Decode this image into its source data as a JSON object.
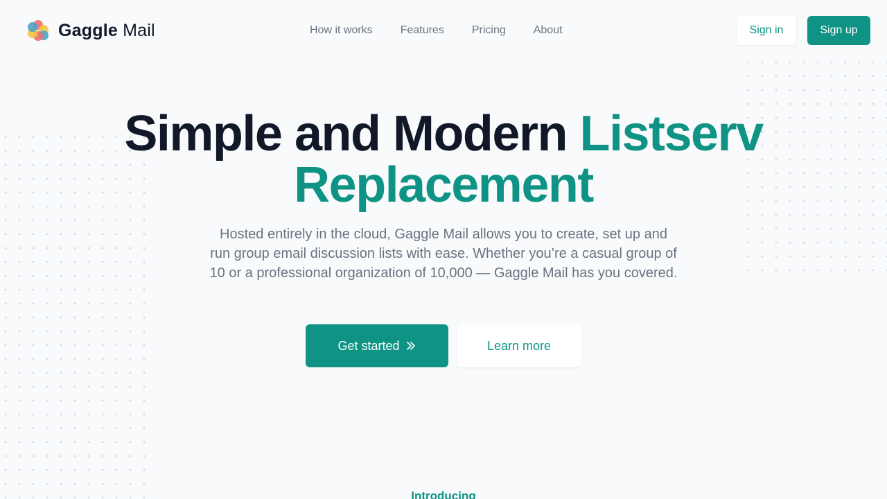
{
  "brand": {
    "name_bold": "Gaggle",
    "name_light": "Mail"
  },
  "nav": {
    "items": [
      "How it works",
      "Features",
      "Pricing",
      "About"
    ]
  },
  "header": {
    "signin_label": "Sign in",
    "signup_label": "Sign up"
  },
  "hero": {
    "headline_dark": "Simple and Modern",
    "headline_accent_1": "Listserv",
    "headline_accent_2": "Replacement",
    "subtext": "Hosted entirely in the cloud, Gaggle Mail allows you to create, set up and run group email discussion lists with ease. Whether you’re a casual group of 10 or a professional organization of 10,000 — Gaggle Mail has you covered.",
    "cta_primary": "Get started",
    "cta_secondary": "Learn more"
  },
  "section": {
    "eyebrow": "Introducing"
  },
  "icons": {
    "cta_primary": "double-chevron-right-icon"
  },
  "colors": {
    "accent": "#0f9384",
    "text_dark": "#111827",
    "text_muted": "#6b7280",
    "background": "#f8fafc"
  }
}
